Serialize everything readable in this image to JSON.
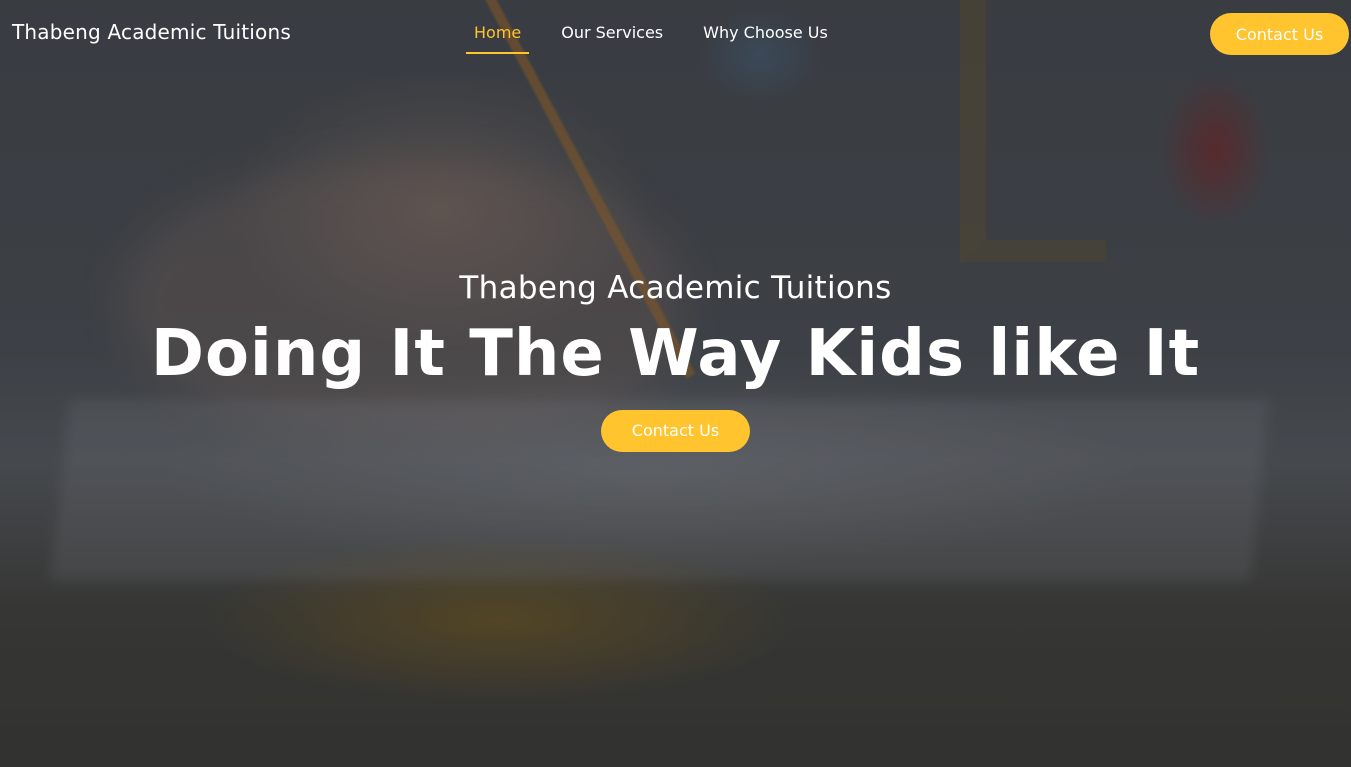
{
  "header": {
    "brand": "Thabeng Academic Tuitions",
    "nav": [
      {
        "label": "Home",
        "active": true
      },
      {
        "label": "Our Services",
        "active": false
      },
      {
        "label": "Why Choose Us",
        "active": false
      }
    ],
    "cta_label": "Contact Us"
  },
  "hero": {
    "subtitle": "Thabeng Academic Tuitions",
    "title": "Doing It The Way Kids like It",
    "cta_label": "Contact Us"
  },
  "colors": {
    "accent": "#ffc42e",
    "text": "#ffffff"
  }
}
